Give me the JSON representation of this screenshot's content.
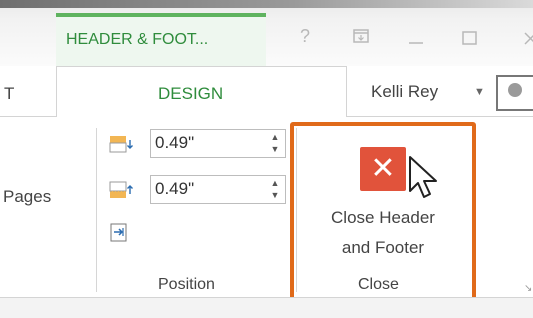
{
  "title_bar": {
    "contextual_tab": "HEADER & FOOT...",
    "help": "?"
  },
  "tabs": {
    "partial_left": "T",
    "design": "DESIGN"
  },
  "account": {
    "user_name": "Kelli Rey"
  },
  "groups": {
    "pages_label": "Pages",
    "position": {
      "header_from_top": "0.49\"",
      "footer_from_bottom": "0.49\"",
      "label": "Position"
    },
    "close": {
      "button_line1": "Close Header",
      "button_line2": "and Footer",
      "label": "Close"
    }
  },
  "colors": {
    "contextual_green": "#2f8c3c",
    "close_red": "#e1533b",
    "highlight_orange": "#e06a1a"
  }
}
